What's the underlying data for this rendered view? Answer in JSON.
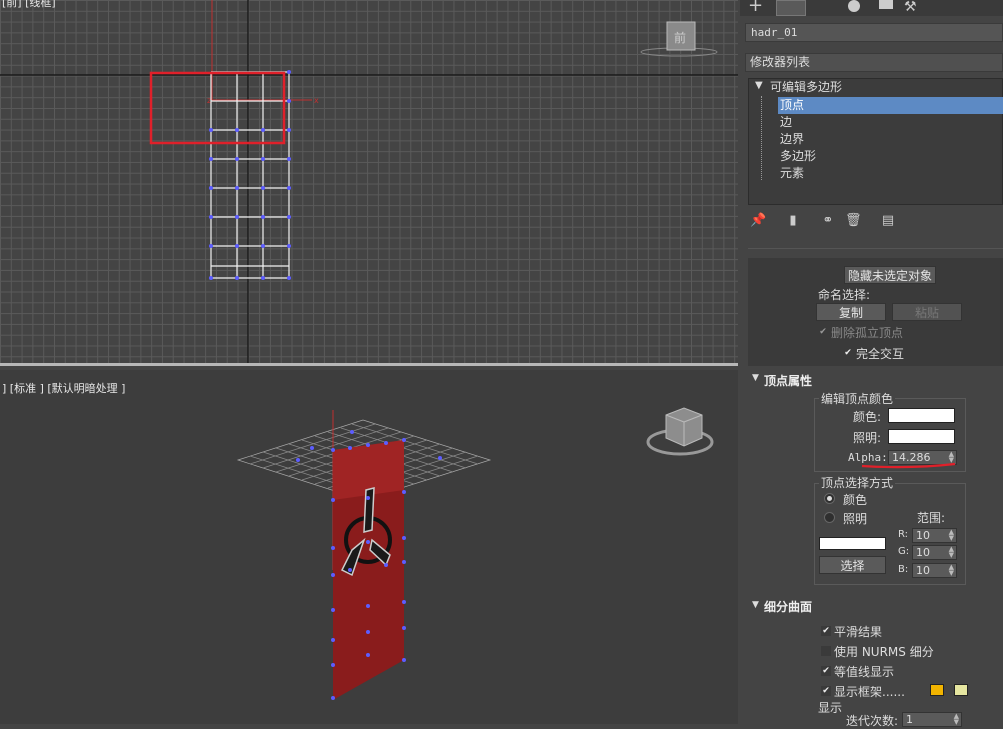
{
  "top_viewport": {
    "label_left": "[前] [线框]"
  },
  "persp_viewport": {
    "label": "] [标准 ] [默认明暗处理 ]"
  },
  "viewcube_top_label": "前",
  "panel": {
    "object_name": "hadr_01",
    "modifier_list": "修改器列表",
    "stack": {
      "root": "可编辑多边形",
      "items": [
        "顶点",
        "边",
        "边界",
        "多边形",
        "元素"
      ],
      "selected": "顶点"
    },
    "selection_rollout": {
      "hide_unselected": "隐藏未选定对象",
      "named_selections": "命名选择:",
      "copy": "复制",
      "paste": "粘贴",
      "delete_isolated": "删除孤立顶点",
      "full_interactivity": "完全交互"
    },
    "vertex_props": {
      "title": "顶点属性",
      "edit_group": "编辑顶点颜色",
      "color_label": "颜色:",
      "illum_label": "照明:",
      "alpha_label": "Alpha:",
      "alpha_value": "14.286",
      "select_by_group": "顶点选择方式",
      "radio_color": "颜色",
      "radio_illum": "照明",
      "range_label": "范围:",
      "r_label": "R:",
      "g_label": "G:",
      "b_label": "B:",
      "r_value": "10",
      "g_value": "10",
      "b_value": "10",
      "select_btn": "选择"
    },
    "subdiv": {
      "title": "细分曲面",
      "smooth_result": "平滑结果",
      "use_nurms": "使用 NURMS 细分",
      "isoline": "等值线显示",
      "show_cage": "显示框架......",
      "display": "显示",
      "iterations_label": "迭代次数:",
      "iterations_value": "1"
    },
    "colors": {
      "cage_color1": "#f2b400",
      "cage_color2": "#e6e6a0",
      "highlight_red": "#e0202a",
      "selection_blue": "#5d8ac4"
    }
  }
}
